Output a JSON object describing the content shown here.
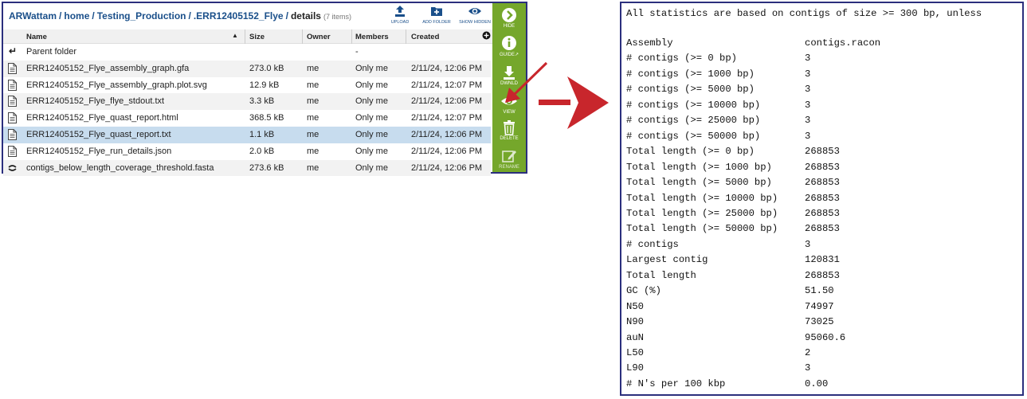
{
  "browser": {
    "breadcrumb": [
      "ARWattam",
      "home",
      "Testing_Production",
      ".ERR12405152_Flye"
    ],
    "current": "details",
    "count": "(7 items)",
    "toolbar": {
      "upload": "UPLOAD",
      "add_folder": "ADD FOLDER",
      "show_hidden": "SHOW HIDDEN"
    },
    "columns": {
      "name": "Name",
      "size": "Size",
      "owner": "Owner",
      "members": "Members",
      "created": "Created"
    },
    "parent": {
      "name": "Parent folder",
      "members": "-"
    },
    "files": [
      {
        "name": "ERR12405152_Flye_assembly_graph.gfa",
        "size": "273.0 kB",
        "owner": "me",
        "members": "Only me",
        "created": "2/11/24, 12:06 PM",
        "icon": "document-icon"
      },
      {
        "name": "ERR12405152_Flye_assembly_graph.plot.svg",
        "size": "12.9 kB",
        "owner": "me",
        "members": "Only me",
        "created": "2/11/24, 12:07 PM",
        "icon": "document-icon"
      },
      {
        "name": "ERR12405152_Flye_flye_stdout.txt",
        "size": "3.3 kB",
        "owner": "me",
        "members": "Only me",
        "created": "2/11/24, 12:06 PM",
        "icon": "document-icon"
      },
      {
        "name": "ERR12405152_Flye_quast_report.html",
        "size": "368.5 kB",
        "owner": "me",
        "members": "Only me",
        "created": "2/11/24, 12:07 PM",
        "icon": "document-icon"
      },
      {
        "name": "ERR12405152_Flye_quast_report.txt",
        "size": "1.1 kB",
        "owner": "me",
        "members": "Only me",
        "created": "2/11/24, 12:06 PM",
        "icon": "document-icon",
        "selected": true
      },
      {
        "name": "ERR12405152_Flye_run_details.json",
        "size": "2.0 kB",
        "owner": "me",
        "members": "Only me",
        "created": "2/11/24, 12:06 PM",
        "icon": "document-icon"
      },
      {
        "name": "contigs_below_length_coverage_threshold.fasta",
        "size": "273.6 kB",
        "owner": "me",
        "members": "Only me",
        "created": "2/11/24, 12:06 PM",
        "icon": "dna-icon"
      }
    ],
    "sidebar": {
      "hide": "HIDE",
      "guide": "GUIDE",
      "download": "DWNLD",
      "view": "VIEW",
      "delete": "DELETE",
      "rename": "RENAME"
    },
    "accent": "#75a72b",
    "link_color": "#1a4f8a",
    "selected_row_color": "#c7dcee",
    "arrow_color": "#c8262c"
  },
  "report": {
    "note": "All statistics are based on contigs of size >= 300 bp, unless",
    "rows": [
      {
        "k": "Assembly",
        "v": "contigs.racon"
      },
      {
        "k": "# contigs (>= 0 bp)",
        "v": "3"
      },
      {
        "k": "# contigs (>= 1000 bp)",
        "v": "3"
      },
      {
        "k": "# contigs (>= 5000 bp)",
        "v": "3"
      },
      {
        "k": "# contigs (>= 10000 bp)",
        "v": "3"
      },
      {
        "k": "# contigs (>= 25000 bp)",
        "v": "3"
      },
      {
        "k": "# contigs (>= 50000 bp)",
        "v": "3"
      },
      {
        "k": "Total length (>= 0 bp)",
        "v": "268853"
      },
      {
        "k": "Total length (>= 1000 bp)",
        "v": "268853"
      },
      {
        "k": "Total length (>= 5000 bp)",
        "v": "268853"
      },
      {
        "k": "Total length (>= 10000 bp)",
        "v": "268853"
      },
      {
        "k": "Total length (>= 25000 bp)",
        "v": "268853"
      },
      {
        "k": "Total length (>= 50000 bp)",
        "v": "268853"
      },
      {
        "k": "# contigs",
        "v": "3"
      },
      {
        "k": "Largest contig",
        "v": "120831"
      },
      {
        "k": "Total length",
        "v": "268853"
      },
      {
        "k": "GC (%)",
        "v": "51.50"
      },
      {
        "k": "N50",
        "v": "74997"
      },
      {
        "k": "N90",
        "v": "73025"
      },
      {
        "k": "auN",
        "v": "95060.6"
      },
      {
        "k": "L50",
        "v": "2"
      },
      {
        "k": "L90",
        "v": "3"
      },
      {
        "k": "# N's per 100 kbp",
        "v": "0.00"
      }
    ]
  }
}
